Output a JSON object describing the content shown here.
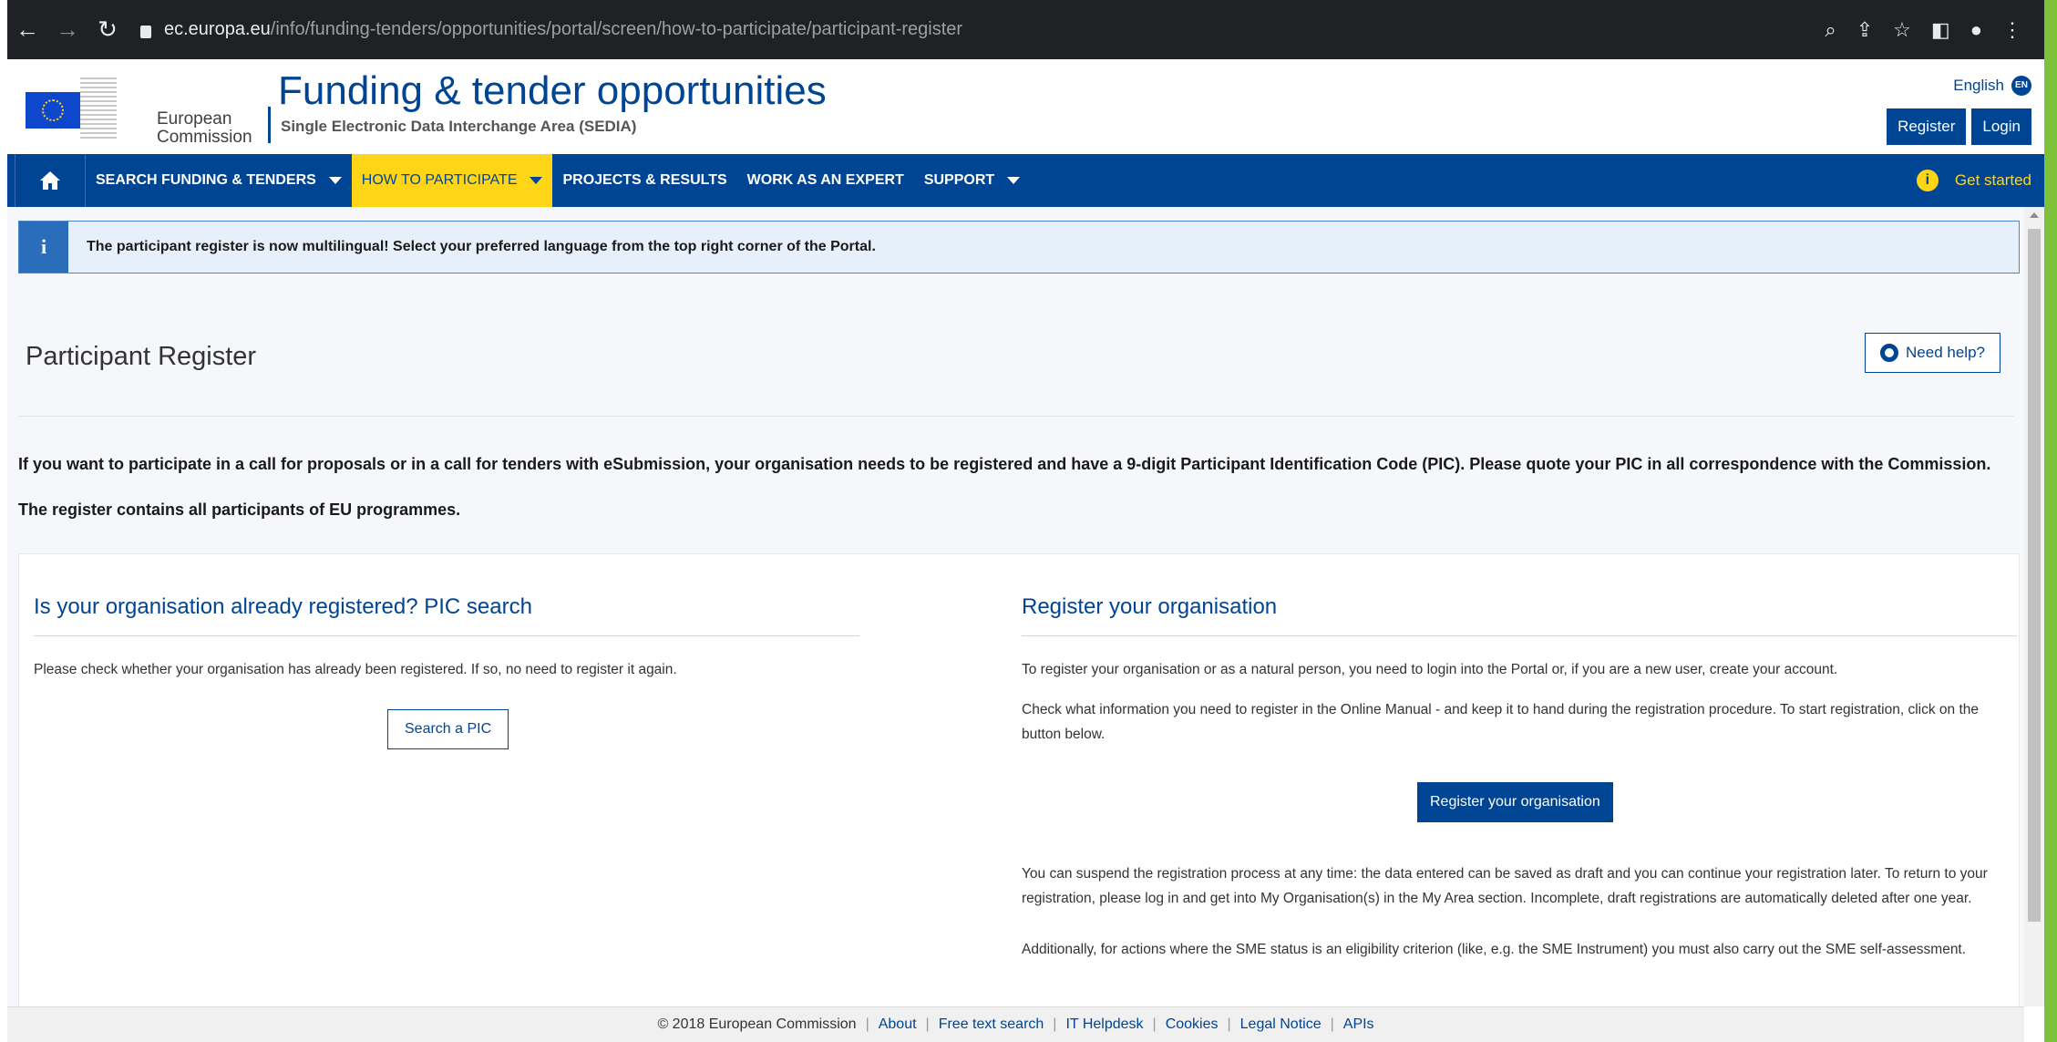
{
  "browser": {
    "url_host": "ec.europa.eu",
    "url_path": "/info/funding-tenders/opportunities/portal/screen/how-to-participate/participant-register"
  },
  "header": {
    "logo_line1": "European",
    "logo_line2": "Commission",
    "title": "Funding & tender opportunities",
    "subtitle": "Single Electronic Data Interchange Area (SEDIA)",
    "language": "English",
    "language_code": "EN",
    "register_label": "Register",
    "login_label": "Login"
  },
  "nav": {
    "items": [
      {
        "label": "SEARCH FUNDING & TENDERS",
        "dropdown": true
      },
      {
        "label": "HOW TO PARTICIPATE",
        "dropdown": true,
        "active": true
      },
      {
        "label": "PROJECTS & RESULTS",
        "dropdown": false
      },
      {
        "label": "WORK AS AN EXPERT",
        "dropdown": false
      },
      {
        "label": "SUPPORT",
        "dropdown": true
      }
    ],
    "get_started": "Get started"
  },
  "notice": {
    "icon": "i",
    "text": "The participant register is now multilingual! Select your preferred language from the top right corner of the Portal."
  },
  "page": {
    "title": "Participant Register",
    "help_label": "Need help?",
    "intro1": "If you want to participate in a call for proposals or in a call for tenders with eSubmission, your organisation needs to be registered and have a 9-digit Participant Identification Code (PIC). Please quote your PIC in all correspondence with the Commission.",
    "intro2": "The register contains all participants of EU programmes."
  },
  "left_col": {
    "title": "Is your organisation already registered? PIC search",
    "text": "Please check whether your organisation has already been registered. If so, no need to register it again.",
    "button": "Search a PIC"
  },
  "right_col": {
    "title": "Register your organisation",
    "p1": "To register your organisation or as a natural person, you need to login into the Portal or, if you are a new user, create your account.",
    "p2": "Check what information you need to register in the Online Manual - and keep it to hand during the registration procedure. To start registration, click on the button below.",
    "button": "Register your organisation",
    "p3": "You can suspend the registration process at any time: the data entered can be saved as draft and you can continue your registration later. To return to your registration, please log in and get into My Organisation(s) in the My Area section. Incomplete, draft registrations are automatically deleted after one year.",
    "p4": "Additionally, for actions where the SME status is an eligibility criterion (like, e.g. the SME Instrument) you must also carry out the SME self-assessment."
  },
  "footer": {
    "copyright": "© 2018 European Commission",
    "links": [
      "About",
      "Free text search",
      "IT Helpdesk",
      "Cookies",
      "Legal Notice",
      "APIs"
    ]
  },
  "colors": {
    "brand_blue": "#004494",
    "brand_yellow": "#ffd617",
    "content_bg": "#f5f7fa"
  }
}
